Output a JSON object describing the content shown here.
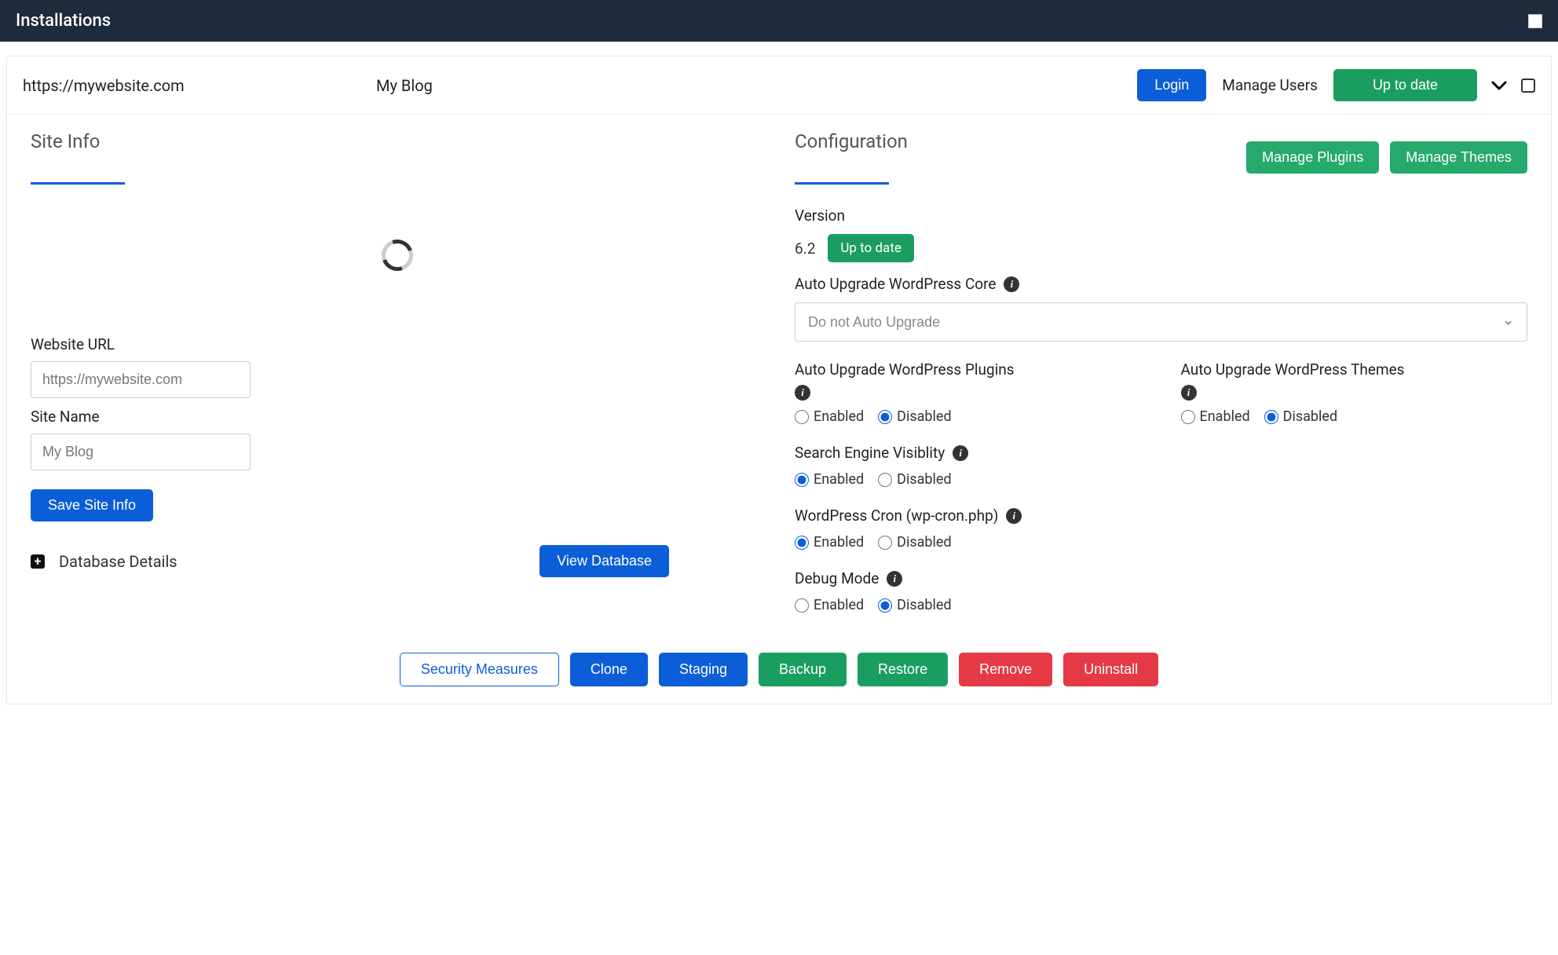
{
  "header": {
    "title": "Installations"
  },
  "site": {
    "url": "https://mywebsite.com",
    "name": "My Blog",
    "login_btn": "Login",
    "manage_users": "Manage Users",
    "status_btn": "Up to date"
  },
  "siteinfo": {
    "title": "Site Info",
    "url_label": "Website URL",
    "url_value": "https://mywebsite.com",
    "name_label": "Site Name",
    "name_value": "My Blog",
    "save_btn": "Save Site Info",
    "db_details": "Database Details",
    "view_db_btn": "View Database"
  },
  "config": {
    "title": "Configuration",
    "manage_plugins": "Manage Plugins",
    "manage_themes": "Manage Themes",
    "version_label": "Version",
    "version_value": "6.2",
    "version_badge": "Up to date",
    "auto_core_label": "Auto Upgrade WordPress Core",
    "auto_core_select": "Do not Auto Upgrade",
    "plugins_label": "Auto Upgrade WordPress Plugins",
    "themes_label": "Auto Upgrade WordPress Themes",
    "search_label": "Search Engine Visiblity",
    "cron_label": "WordPress Cron (wp-cron.php)",
    "debug_label": "Debug Mode",
    "enabled": "Enabled",
    "disabled": "Disabled"
  },
  "footer": {
    "security": "Security Measures",
    "clone": "Clone",
    "staging": "Staging",
    "backup": "Backup",
    "restore": "Restore",
    "remove": "Remove",
    "uninstall": "Uninstall"
  }
}
